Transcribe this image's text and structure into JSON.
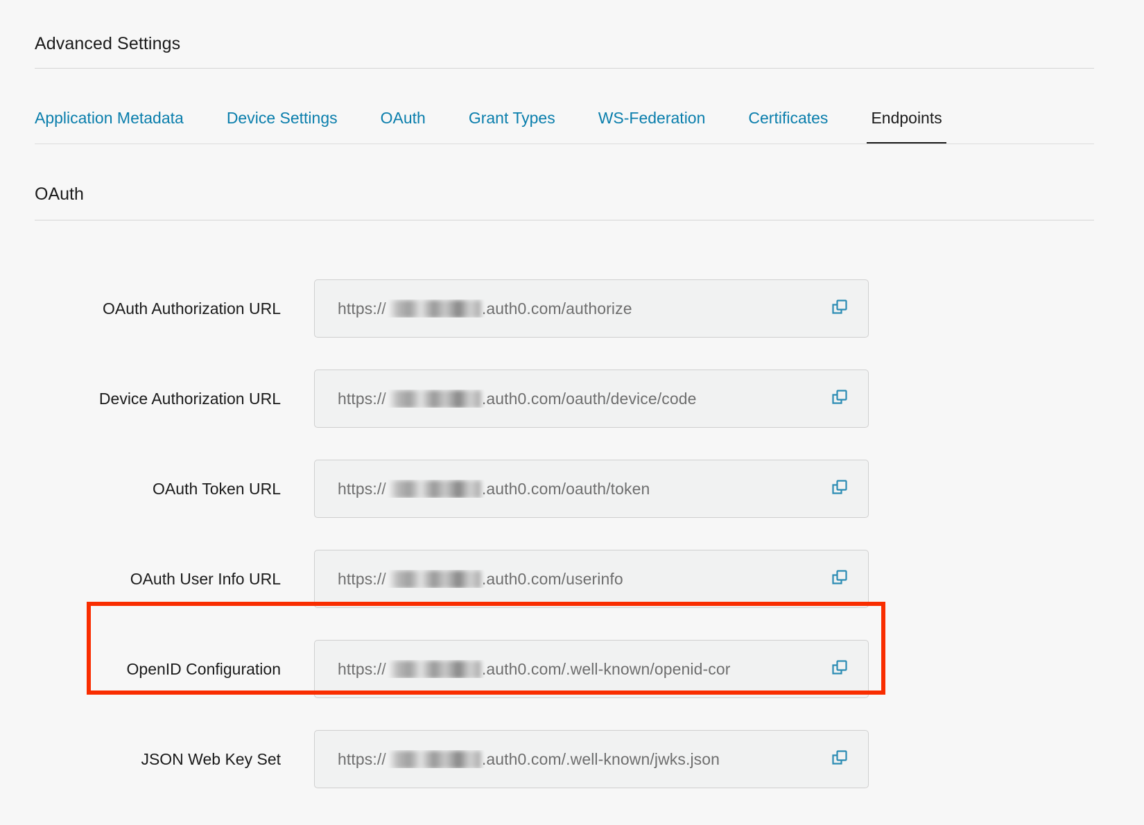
{
  "header": {
    "title": "Advanced Settings"
  },
  "tabs": [
    {
      "label": "Application Metadata",
      "active": false
    },
    {
      "label": "Device Settings",
      "active": false
    },
    {
      "label": "OAuth",
      "active": false
    },
    {
      "label": "Grant Types",
      "active": false
    },
    {
      "label": "WS-Federation",
      "active": false
    },
    {
      "label": "Certificates",
      "active": false
    },
    {
      "label": "Endpoints",
      "active": true
    }
  ],
  "section": {
    "title": "OAuth"
  },
  "rows": [
    {
      "label": "OAuth Authorization URL",
      "prefix": "https://",
      "redacted": true,
      "suffix": ".auth0.com/authorize",
      "copy_icon": "copy-icon",
      "highlighted": false
    },
    {
      "label": "Device Authorization URL",
      "prefix": "https://",
      "redacted": true,
      "suffix": ".auth0.com/oauth/device/code",
      "copy_icon": "copy-icon",
      "highlighted": false
    },
    {
      "label": "OAuth Token URL",
      "prefix": "https://",
      "redacted": true,
      "suffix": ".auth0.com/oauth/token",
      "copy_icon": "copy-icon",
      "highlighted": false
    },
    {
      "label": "OAuth User Info URL",
      "prefix": "https://",
      "redacted": true,
      "suffix": ".auth0.com/userinfo",
      "copy_icon": "copy-icon",
      "highlighted": false
    },
    {
      "label": "OpenID Configuration",
      "prefix": "https://",
      "redacted": true,
      "suffix": ".auth0.com/.well-known/openid-cor",
      "copy_icon": "copy-icon",
      "highlighted": true
    },
    {
      "label": "JSON Web Key Set",
      "prefix": "https://",
      "redacted": true,
      "suffix": ".auth0.com/.well-known/jwks.json",
      "copy_icon": "copy-icon",
      "highlighted": false
    }
  ],
  "colors": {
    "page_background": "#f7f7f7",
    "link_blue": "#0a7eac",
    "icon_blue": "#2b8cb4",
    "highlight_red": "#f92d00",
    "field_background": "#f1f2f2",
    "field_border": "#cfcfcf",
    "text": "#1a1a1a",
    "value_text": "#6e6e6e"
  }
}
